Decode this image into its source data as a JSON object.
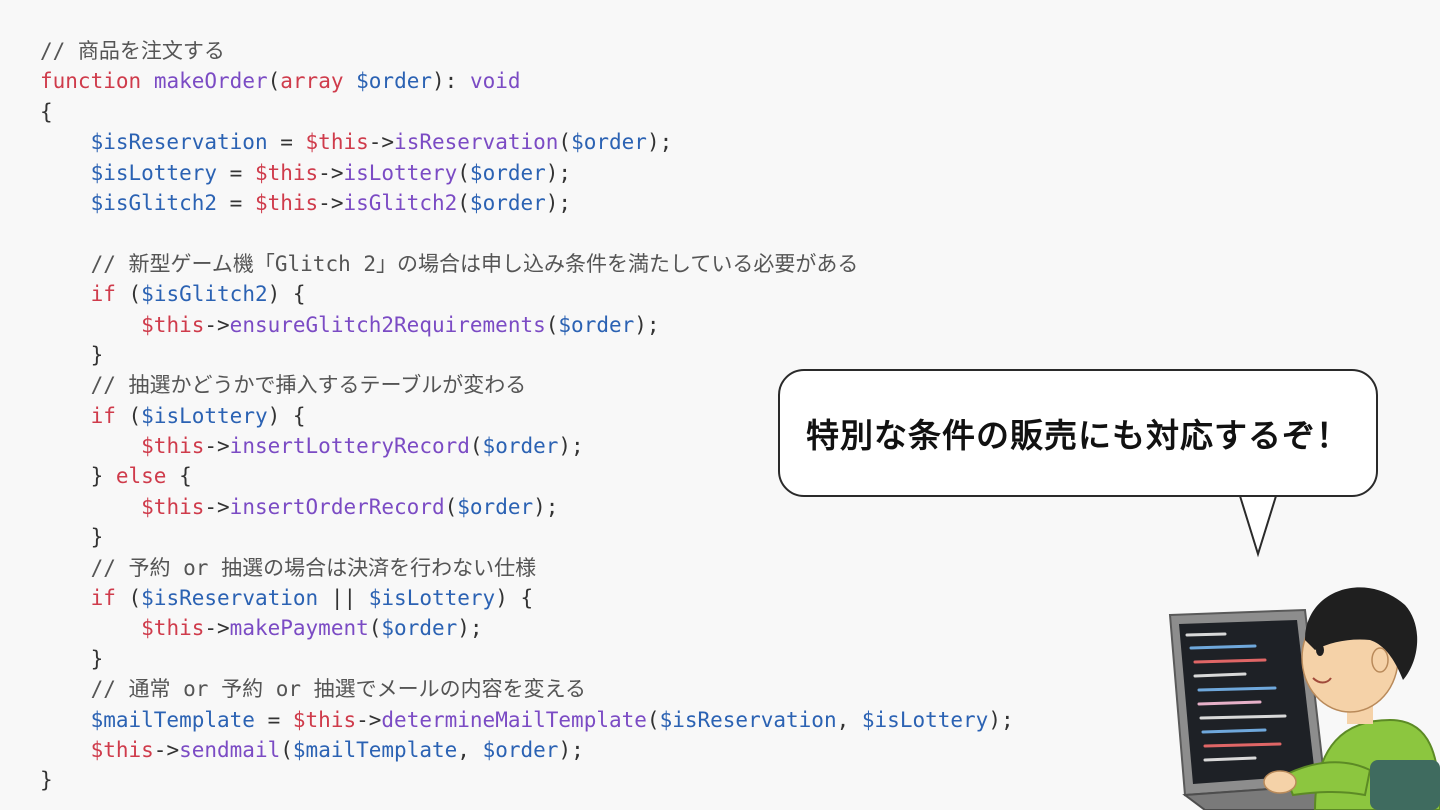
{
  "code": {
    "lines": [
      {
        "indent": 0,
        "tokens": [
          {
            "t": "// 商品を注文する",
            "c": "c"
          }
        ]
      },
      {
        "indent": 0,
        "tokens": [
          {
            "t": "function",
            "c": "k"
          },
          {
            "t": " ",
            "c": "p"
          },
          {
            "t": "makeOrder",
            "c": "f"
          },
          {
            "t": "(",
            "c": "p"
          },
          {
            "t": "array",
            "c": "k"
          },
          {
            "t": " ",
            "c": "p"
          },
          {
            "t": "$order",
            "c": "v"
          },
          {
            "t": "): ",
            "c": "p"
          },
          {
            "t": "void",
            "c": "f"
          }
        ]
      },
      {
        "indent": 0,
        "tokens": [
          {
            "t": "{",
            "c": "p"
          }
        ]
      },
      {
        "indent": 1,
        "tokens": [
          {
            "t": "$isReservation",
            "c": "v"
          },
          {
            "t": " = ",
            "c": "p"
          },
          {
            "t": "$this",
            "c": "t"
          },
          {
            "t": "->",
            "c": "p"
          },
          {
            "t": "isReservation",
            "c": "f"
          },
          {
            "t": "(",
            "c": "p"
          },
          {
            "t": "$order",
            "c": "v"
          },
          {
            "t": ");",
            "c": "p"
          }
        ]
      },
      {
        "indent": 1,
        "tokens": [
          {
            "t": "$isLottery",
            "c": "v"
          },
          {
            "t": " = ",
            "c": "p"
          },
          {
            "t": "$this",
            "c": "t"
          },
          {
            "t": "->",
            "c": "p"
          },
          {
            "t": "isLottery",
            "c": "f"
          },
          {
            "t": "(",
            "c": "p"
          },
          {
            "t": "$order",
            "c": "v"
          },
          {
            "t": ");",
            "c": "p"
          }
        ]
      },
      {
        "indent": 1,
        "tokens": [
          {
            "t": "$isGlitch2",
            "c": "v"
          },
          {
            "t": " = ",
            "c": "p"
          },
          {
            "t": "$this",
            "c": "t"
          },
          {
            "t": "->",
            "c": "p"
          },
          {
            "t": "isGlitch2",
            "c": "f"
          },
          {
            "t": "(",
            "c": "p"
          },
          {
            "t": "$order",
            "c": "v"
          },
          {
            "t": ");",
            "c": "p"
          }
        ]
      },
      {
        "indent": 0,
        "tokens": []
      },
      {
        "indent": 1,
        "tokens": [
          {
            "t": "// 新型ゲーム機「Glitch 2」の場合は申し込み条件を満たしている必要がある",
            "c": "c"
          }
        ]
      },
      {
        "indent": 1,
        "tokens": [
          {
            "t": "if",
            "c": "k"
          },
          {
            "t": " (",
            "c": "p"
          },
          {
            "t": "$isGlitch2",
            "c": "v"
          },
          {
            "t": ") {",
            "c": "p"
          }
        ]
      },
      {
        "indent": 2,
        "tokens": [
          {
            "t": "$this",
            "c": "t"
          },
          {
            "t": "->",
            "c": "p"
          },
          {
            "t": "ensureGlitch2Requirements",
            "c": "f"
          },
          {
            "t": "(",
            "c": "p"
          },
          {
            "t": "$order",
            "c": "v"
          },
          {
            "t": ");",
            "c": "p"
          }
        ]
      },
      {
        "indent": 1,
        "tokens": [
          {
            "t": "}",
            "c": "p"
          }
        ]
      },
      {
        "indent": 1,
        "tokens": [
          {
            "t": "// 抽選かどうかで挿入するテーブルが変わる",
            "c": "c"
          }
        ]
      },
      {
        "indent": 1,
        "tokens": [
          {
            "t": "if",
            "c": "k"
          },
          {
            "t": " (",
            "c": "p"
          },
          {
            "t": "$isLottery",
            "c": "v"
          },
          {
            "t": ") {",
            "c": "p"
          }
        ]
      },
      {
        "indent": 2,
        "tokens": [
          {
            "t": "$this",
            "c": "t"
          },
          {
            "t": "->",
            "c": "p"
          },
          {
            "t": "insertLotteryRecord",
            "c": "f"
          },
          {
            "t": "(",
            "c": "p"
          },
          {
            "t": "$order",
            "c": "v"
          },
          {
            "t": ");",
            "c": "p"
          }
        ]
      },
      {
        "indent": 1,
        "tokens": [
          {
            "t": "} ",
            "c": "p"
          },
          {
            "t": "else",
            "c": "k"
          },
          {
            "t": " {",
            "c": "p"
          }
        ]
      },
      {
        "indent": 2,
        "tokens": [
          {
            "t": "$this",
            "c": "t"
          },
          {
            "t": "->",
            "c": "p"
          },
          {
            "t": "insertOrderRecord",
            "c": "f"
          },
          {
            "t": "(",
            "c": "p"
          },
          {
            "t": "$order",
            "c": "v"
          },
          {
            "t": ");",
            "c": "p"
          }
        ]
      },
      {
        "indent": 1,
        "tokens": [
          {
            "t": "}",
            "c": "p"
          }
        ]
      },
      {
        "indent": 1,
        "tokens": [
          {
            "t": "// 予約 or 抽選の場合は決済を行わない仕様",
            "c": "c"
          }
        ]
      },
      {
        "indent": 1,
        "tokens": [
          {
            "t": "if",
            "c": "k"
          },
          {
            "t": " (",
            "c": "p"
          },
          {
            "t": "$isReservation",
            "c": "v"
          },
          {
            "t": " || ",
            "c": "p"
          },
          {
            "t": "$isLottery",
            "c": "v"
          },
          {
            "t": ") {",
            "c": "p"
          }
        ]
      },
      {
        "indent": 2,
        "tokens": [
          {
            "t": "$this",
            "c": "t"
          },
          {
            "t": "->",
            "c": "p"
          },
          {
            "t": "makePayment",
            "c": "f"
          },
          {
            "t": "(",
            "c": "p"
          },
          {
            "t": "$order",
            "c": "v"
          },
          {
            "t": ");",
            "c": "p"
          }
        ]
      },
      {
        "indent": 1,
        "tokens": [
          {
            "t": "}",
            "c": "p"
          }
        ]
      },
      {
        "indent": 1,
        "tokens": [
          {
            "t": "// 通常 or 予約 or 抽選でメールの内容を変える",
            "c": "c"
          }
        ]
      },
      {
        "indent": 1,
        "tokens": [
          {
            "t": "$mailTemplate",
            "c": "v"
          },
          {
            "t": " = ",
            "c": "p"
          },
          {
            "t": "$this",
            "c": "t"
          },
          {
            "t": "->",
            "c": "p"
          },
          {
            "t": "determineMailTemplate",
            "c": "f"
          },
          {
            "t": "(",
            "c": "p"
          },
          {
            "t": "$isReservation",
            "c": "v"
          },
          {
            "t": ", ",
            "c": "p"
          },
          {
            "t": "$isLottery",
            "c": "v"
          },
          {
            "t": ");",
            "c": "p"
          }
        ]
      },
      {
        "indent": 1,
        "tokens": [
          {
            "t": "$this",
            "c": "t"
          },
          {
            "t": "->",
            "c": "p"
          },
          {
            "t": "sendmail",
            "c": "f"
          },
          {
            "t": "(",
            "c": "p"
          },
          {
            "t": "$mailTemplate",
            "c": "v"
          },
          {
            "t": ", ",
            "c": "p"
          },
          {
            "t": "$order",
            "c": "v"
          },
          {
            "t": ");",
            "c": "p"
          }
        ]
      },
      {
        "indent": 0,
        "tokens": [
          {
            "t": "}",
            "c": "p"
          }
        ]
      }
    ]
  },
  "bubble": {
    "text": "特別な条件の販売にも対応するぞ！"
  },
  "colors": {
    "background": "#f8f8f8",
    "keyword": "#cf3b4b",
    "function": "#7b4bc4",
    "variable": "#2b62b3",
    "comment": "#555555",
    "shirt": "#8cc63f"
  },
  "illustration": {
    "icon": "programmer-at-laptop-icon"
  }
}
